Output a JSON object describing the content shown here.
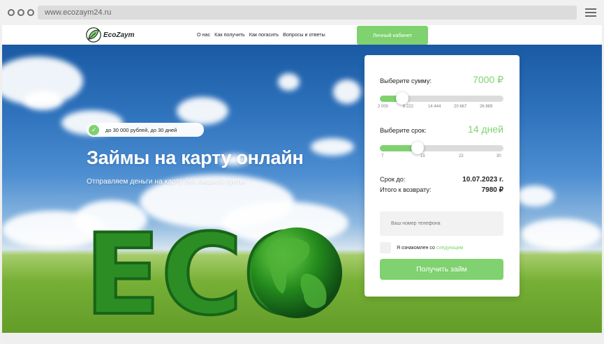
{
  "browser": {
    "url": "www.ecozaym24.ru"
  },
  "nav": {
    "logo_text": "EcoZaym",
    "links": [
      "О нас",
      "Как получить",
      "Как погасить",
      "Вопросы и ответы"
    ],
    "cabinet_button": "Личный кабинет"
  },
  "hero": {
    "badge": "до 30 000 рублей, до 30 дней",
    "title": "Займы на карту онлайн",
    "subtitle": "Отправляем деньги на карту без лишней суеты",
    "eco_letters": "ECO"
  },
  "calculator": {
    "amount_label": "Выберите сумму:",
    "amount_value": "7000 ₽",
    "amount_min": 2000,
    "amount_max": 30000,
    "amount_selected": 7000,
    "amount_scale": [
      "2 000",
      "8 222",
      "14 444",
      "20 667",
      "26 889"
    ],
    "term_label": "Выберите срок:",
    "term_value": "14 дней",
    "term_min": 7,
    "term_max": 30,
    "term_selected": 14,
    "term_scale": [
      "7",
      "15",
      "22",
      "30"
    ],
    "due_label": "Срок до:",
    "due_value": "10.07.2023 г.",
    "return_label": "Итого к возврату:",
    "return_value": "7980 ₽",
    "phone_placeholder": "Ваш номер телефона",
    "agree_text": "Я ознакомлен со",
    "agree_link": "следующим",
    "submit_button": "Получить займ"
  },
  "colors": {
    "accent": "#7fd26f",
    "sky": "#2f73bd",
    "grass": "#6aa62d"
  }
}
